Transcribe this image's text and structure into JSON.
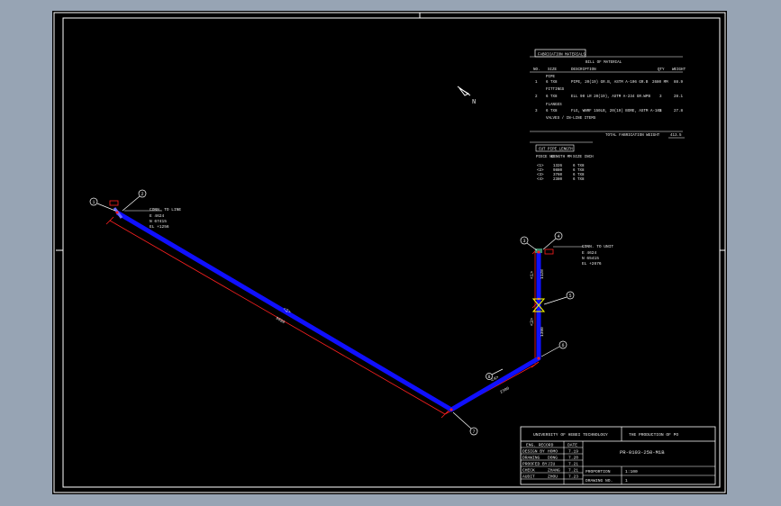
{
  "colors": {
    "background": "#97a4b4",
    "sheet": "#000000",
    "frame": "#ffffff",
    "pipe": "#1010ff",
    "dimension": "#ff2020",
    "weld": "#ff2020",
    "text": "#e8e8e8",
    "valve": "#ffff00"
  },
  "north_label": "N",
  "bom": {
    "tab_label": "FABRICATION MATERIALS",
    "title": "BILL OF MATERIAL",
    "headers": {
      "no": "NO.",
      "size": "SIZE",
      "description": "DESCRIPTION",
      "qty": "QTY",
      "weight": "WEIGHT"
    },
    "groups": [
      {
        "label": "PIPE",
        "rows": [
          {
            "no": "1",
            "size": "6 TX8",
            "desc": "PIPE, 20(19) GR.B, ASTM A-106 GR.B",
            "qty": "2680 MM",
            "weight": "88.9"
          }
        ]
      },
      {
        "label": "FITTINGS",
        "rows": [
          {
            "no": "2",
            "size": "6 TX8",
            "desc": "ELL 90 LR 20(19), ASTM A-234 GR.WPB",
            "qty": "3",
            "weight": "28.1"
          }
        ]
      },
      {
        "label": "FLANGES",
        "rows": [
          {
            "no": "3",
            "size": "6 TX8",
            "desc": "FLG, WNRF 150LB, 20(19) BORE, ASTM A-105",
            "qty": "2",
            "weight": "27.8"
          }
        ]
      }
    ],
    "valves_label": "VALVES / IN-LINE ITEMS",
    "total_label": "TOTAL FABRICATION WEIGHT",
    "total_value": "413.5"
  },
  "cut_table": {
    "title": "CUT PIPE LENGTH",
    "headers": [
      "PIECE NO",
      "LENGTH MM",
      "SIZE INCH"
    ],
    "rows": [
      [
        "<1>",
        "1326",
        "6 TX8"
      ],
      [
        "<2>",
        "9880",
        "6 TX8"
      ],
      [
        "<3>",
        "3760",
        "6 TX8"
      ],
      [
        "<4>",
        "2380",
        "6 TX8"
      ]
    ]
  },
  "connections": {
    "left": {
      "title": "CONN. TO LINE",
      "lines": [
        "E 4624",
        "N 67415",
        "EL +1256"
      ]
    },
    "right": {
      "title": "CONN. TO UNIT",
      "lines": [
        "E 4624",
        "N 65415",
        "EL +2676"
      ]
    }
  },
  "callouts": [
    "1",
    "2",
    "3",
    "4",
    "5",
    "6",
    "7",
    "8"
  ],
  "dims": {
    "long_run": "9880",
    "short_run": "2380",
    "lower_vertical": "1390",
    "upper_vertical": "1128"
  },
  "piece_tags": [
    "<1>",
    "<2>",
    "<3>",
    "<4>"
  ],
  "title_block": {
    "university": "UNIVERSITY OF HEBEI TECHNOLOGY",
    "project": "THE PRODUCTION OF PO",
    "drawing_no": "PR-0103-250-M1B",
    "record_label": "ENG. RECORD",
    "date_label": "DATE",
    "rows": [
      {
        "role": "DESIGN BY",
        "name": "HOMO",
        "date": "7.19"
      },
      {
        "role": "DRAWING",
        "name": "DONG",
        "date": "7.20"
      },
      {
        "role": "PROOFED BY",
        "name": "JIU",
        "date": "7.21"
      },
      {
        "role": "CHECK",
        "name": "ZHANG",
        "date": "7.21"
      },
      {
        "role": "AUDIT",
        "name": "ZHOU",
        "date": "7.23"
      }
    ],
    "proportion_label": "PROPORTION",
    "proportion_value": "1:100",
    "drawing_no_label": "DRAWING NO.",
    "drawing_no_value": "1"
  }
}
